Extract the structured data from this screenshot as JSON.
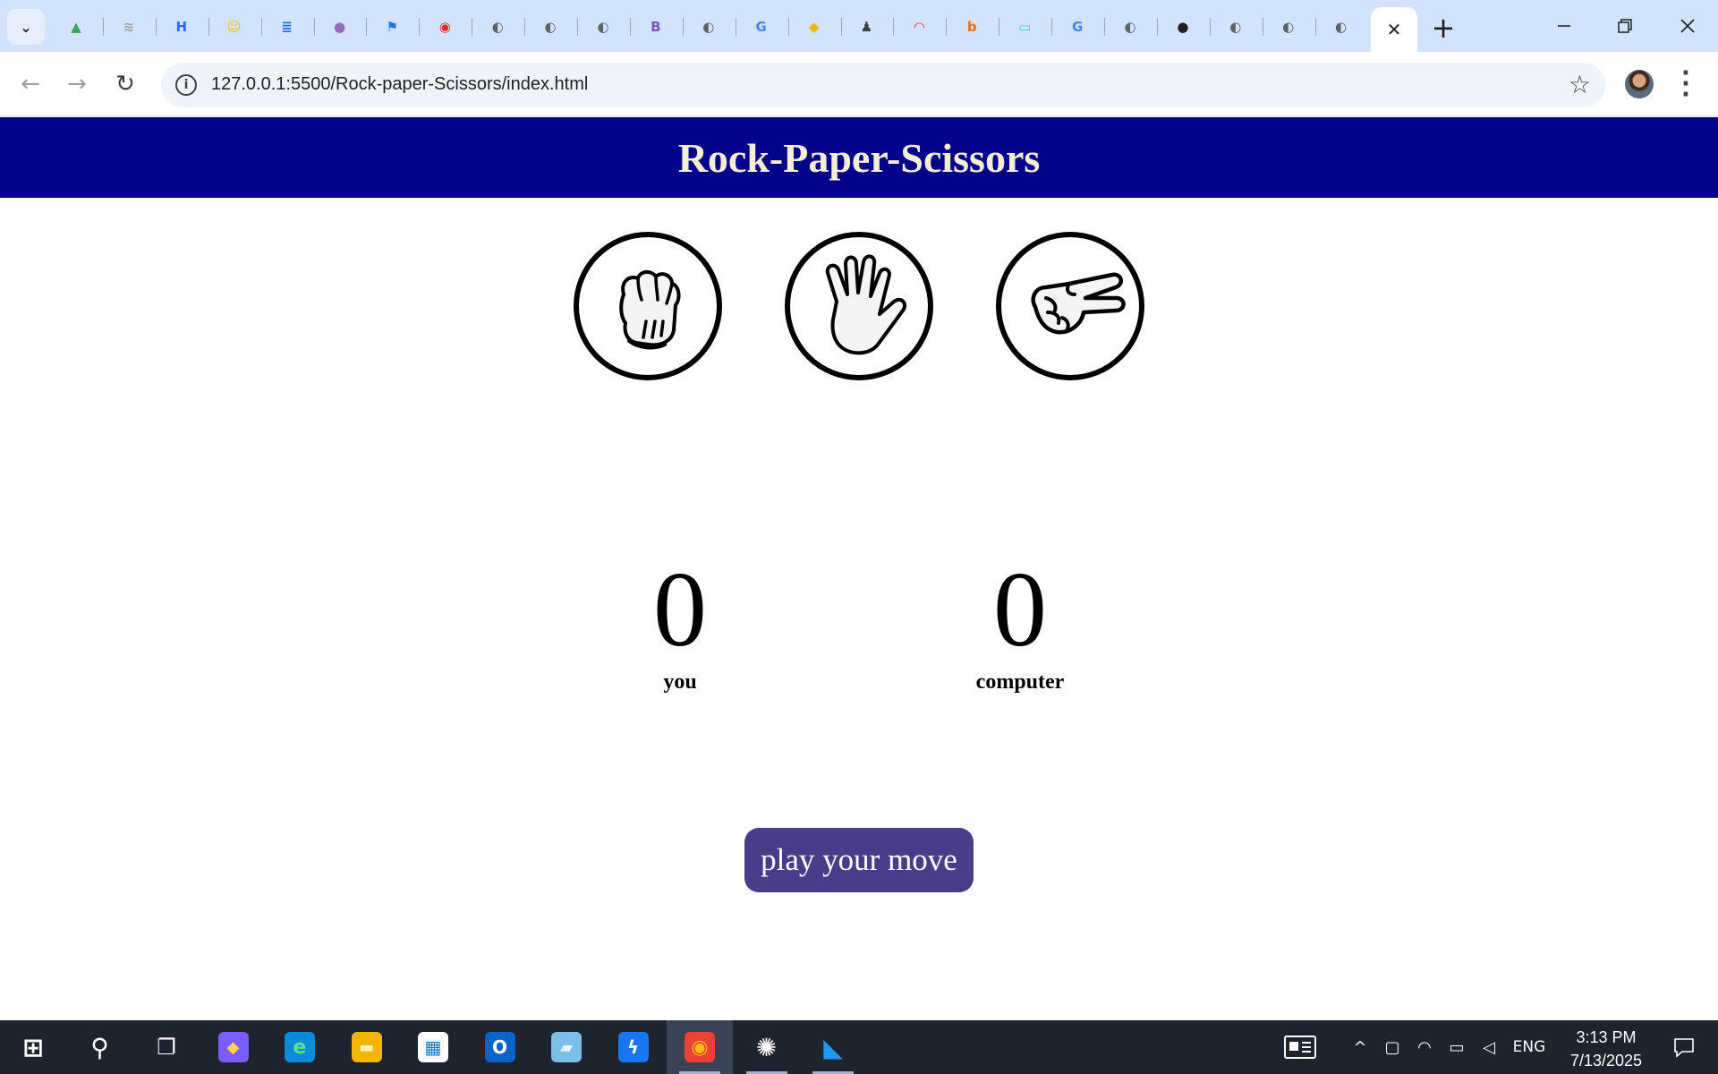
{
  "browser": {
    "tabs": [
      {
        "icon": "google-drive-icon",
        "color": "#34a853",
        "glyph": "▲"
      },
      {
        "icon": "feather-icon",
        "color": "#9aa0a6",
        "glyph": "≋"
      },
      {
        "icon": "hive-icon",
        "color": "#2b6bff",
        "glyph": "H"
      },
      {
        "icon": "smiley-icon",
        "color": "#f2c500",
        "glyph": "☺"
      },
      {
        "icon": "document-icon",
        "color": "#1a73e8",
        "glyph": "≣"
      },
      {
        "icon": "avatar-icon",
        "color": "#8e6bbf",
        "glyph": "●"
      },
      {
        "icon": "flag-icon",
        "color": "#1a73e8",
        "glyph": "⚑"
      },
      {
        "icon": "screenshot-icon",
        "color": "#d93025",
        "glyph": "◉"
      },
      {
        "icon": "globe-icon",
        "color": "#5f6368",
        "glyph": "◐"
      },
      {
        "icon": "globe-icon",
        "color": "#5f6368",
        "glyph": "◐"
      },
      {
        "icon": "globe-icon",
        "color": "#5f6368",
        "glyph": "◐"
      },
      {
        "icon": "bootstrap-icon",
        "color": "#7952b3",
        "glyph": "B"
      },
      {
        "icon": "globe-icon",
        "color": "#5f6368",
        "glyph": "◐"
      },
      {
        "icon": "google-icon",
        "color": "#4285f4",
        "glyph": "G"
      },
      {
        "icon": "graduation-cap-icon",
        "color": "#f4b400",
        "glyph": "◆"
      },
      {
        "icon": "incognito-icon",
        "color": "#3c4043",
        "glyph": "♟"
      },
      {
        "icon": "speedometer-icon",
        "color": "#d93025",
        "glyph": "◠"
      },
      {
        "icon": "b-circle-icon",
        "color": "#ff6d00",
        "glyph": "b"
      },
      {
        "icon": "screen-capture-icon",
        "color": "#4fc3f7",
        "glyph": "▭"
      },
      {
        "icon": "google-icon",
        "color": "#4285f4",
        "glyph": "G"
      },
      {
        "icon": "globe-icon",
        "color": "#5f6368",
        "glyph": "◐"
      },
      {
        "icon": "github-icon",
        "color": "#1f1f1f",
        "glyph": "●"
      },
      {
        "icon": "globe-icon",
        "color": "#5f6368",
        "glyph": "◐"
      },
      {
        "icon": "globe-icon",
        "color": "#5f6368",
        "glyph": "◐"
      },
      {
        "icon": "globe-icon",
        "color": "#5f6368",
        "glyph": "◐"
      }
    ],
    "url": "127.0.0.1:5500/Rock-paper-Scissors/index.html"
  },
  "page": {
    "title": "Rock-Paper-Scissors",
    "choices": [
      {
        "name": "rock"
      },
      {
        "name": "paper"
      },
      {
        "name": "scissors"
      }
    ],
    "scores": {
      "user": {
        "value": "0",
        "label": "you"
      },
      "computer": {
        "value": "0",
        "label": "computer"
      }
    },
    "message": "play your move",
    "colors": {
      "header_bg": "#04048a",
      "header_text": "#f5edd4",
      "button_bg": "#483d8b"
    }
  },
  "taskbar": {
    "apps": [
      {
        "name": "start-icon"
      },
      {
        "name": "search-icon"
      },
      {
        "name": "task-view-icon"
      },
      {
        "name": "copilot-icon"
      },
      {
        "name": "edge-icon"
      },
      {
        "name": "file-explorer-icon"
      },
      {
        "name": "microsoft-store-icon"
      },
      {
        "name": "outlook-icon"
      },
      {
        "name": "notepad-icon"
      },
      {
        "name": "messenger-icon"
      },
      {
        "name": "chrome-icon"
      },
      {
        "name": "chatgpt-icon"
      },
      {
        "name": "vscode-icon"
      }
    ],
    "language": "ENG",
    "time": "3:13 PM",
    "date": "7/13/2025"
  }
}
